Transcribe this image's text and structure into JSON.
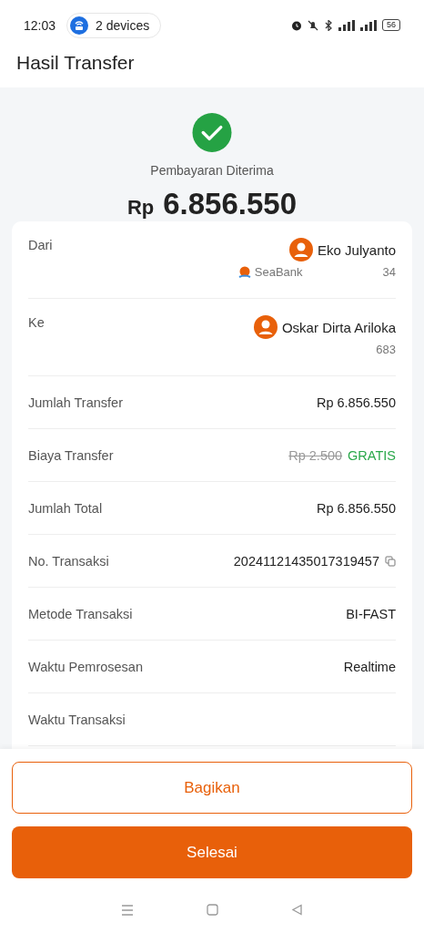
{
  "status_bar": {
    "time": "12:03",
    "hotspot": "2 devices",
    "battery": "56"
  },
  "header": {
    "title": "Hasil Transfer"
  },
  "result": {
    "status": "Pembayaran Diterima",
    "currency": "Rp",
    "amount": "6.856.550"
  },
  "details": [
    {
      "kind": "party",
      "label": "Dari",
      "name": "Eko Julyanto",
      "bank": "SeaBank",
      "account_tail": "34"
    },
    {
      "kind": "party",
      "label": "Ke",
      "name": "Oskar Dirta Ariloka",
      "account_tail": "683"
    },
    {
      "kind": "plain",
      "label": "Jumlah Transfer",
      "value": "Rp 6.856.550"
    },
    {
      "kind": "fee",
      "label": "Biaya Transfer",
      "old_value": "Rp 2.500",
      "value": "GRATIS"
    },
    {
      "kind": "plain",
      "label": "Jumlah Total",
      "value": "Rp 6.856.550"
    },
    {
      "kind": "copy",
      "label": "No. Transaksi",
      "value": "20241121435017319457"
    },
    {
      "kind": "plain",
      "label": "Metode Transaksi",
      "value": "BI-FAST"
    },
    {
      "kind": "plain",
      "label": "Waktu Pemrosesan",
      "value": "Realtime"
    },
    {
      "kind": "plain",
      "label": "Waktu Transaksi"
    }
  ],
  "buttons": {
    "share": "Bagikan",
    "done": "Selesai"
  }
}
